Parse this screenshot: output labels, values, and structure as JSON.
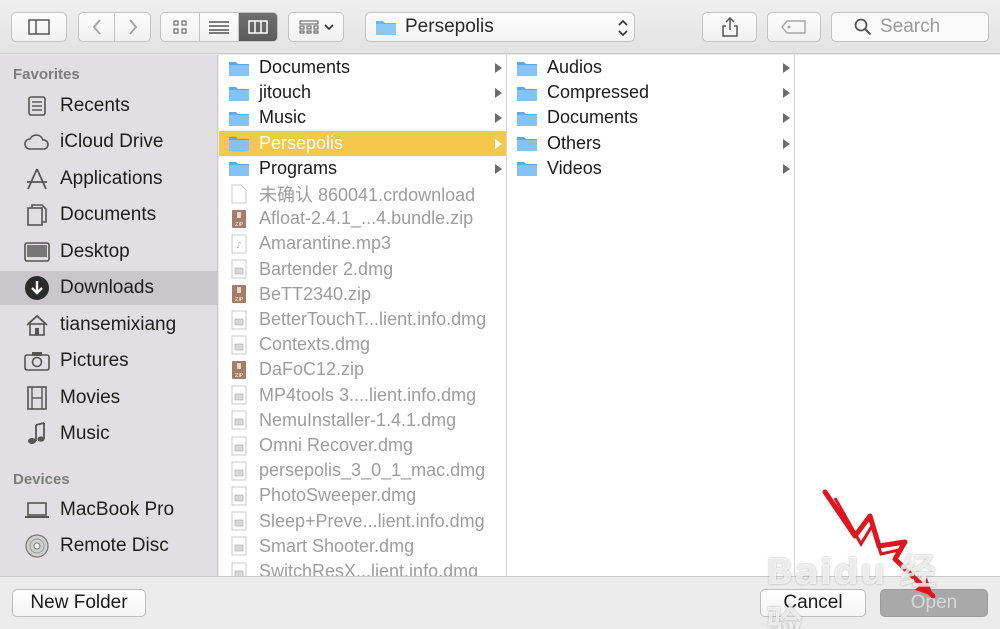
{
  "toolbar": {
    "path_label": "Persepolis",
    "search_placeholder": "Search"
  },
  "sidebar": {
    "favorites_header": "Favorites",
    "favorites": [
      {
        "label": "Recents",
        "icon": "recents-icon"
      },
      {
        "label": "iCloud Drive",
        "icon": "cloud-icon"
      },
      {
        "label": "Applications",
        "icon": "applications-icon"
      },
      {
        "label": "Documents",
        "icon": "document-icon"
      },
      {
        "label": "Desktop",
        "icon": "desktop-icon"
      },
      {
        "label": "Downloads",
        "icon": "download-icon",
        "selected": true
      },
      {
        "label": "tiansemixiang",
        "icon": "home-icon"
      },
      {
        "label": "Pictures",
        "icon": "camera-icon"
      },
      {
        "label": "Movies",
        "icon": "film-icon"
      },
      {
        "label": "Music",
        "icon": "music-note-icon"
      }
    ],
    "devices_header": "Devices",
    "devices": [
      {
        "label": "MacBook Pro",
        "icon": "laptop-icon"
      },
      {
        "label": "Remote Disc",
        "icon": "disc-icon"
      }
    ]
  },
  "column1": {
    "items": [
      {
        "label": "Documents",
        "kind": "folder"
      },
      {
        "label": "jitouch",
        "kind": "folder"
      },
      {
        "label": "Music",
        "kind": "folder"
      },
      {
        "label": "Persepolis",
        "kind": "folder",
        "selected": true
      },
      {
        "label": "Programs",
        "kind": "folder"
      },
      {
        "label": "未确认 860041.crdownload",
        "kind": "blank"
      },
      {
        "label": "Afloat-2.4.1_...4.bundle.zip",
        "kind": "zip"
      },
      {
        "label": "Amarantine.mp3",
        "kind": "audio"
      },
      {
        "label": "Bartender 2.dmg",
        "kind": "dmg"
      },
      {
        "label": "BeTT2340.zip",
        "kind": "zip"
      },
      {
        "label": "BetterTouchT...lient.info.dmg",
        "kind": "dmg"
      },
      {
        "label": "Contexts.dmg",
        "kind": "dmg"
      },
      {
        "label": "DaFoC12.zip",
        "kind": "zip"
      },
      {
        "label": "MP4tools 3....lient.info.dmg",
        "kind": "dmg"
      },
      {
        "label": "NemuInstaller-1.4.1.dmg",
        "kind": "dmg"
      },
      {
        "label": "Omni Recover.dmg",
        "kind": "dmg"
      },
      {
        "label": "persepolis_3_0_1_mac.dmg",
        "kind": "dmg"
      },
      {
        "label": "PhotoSweeper.dmg",
        "kind": "dmg"
      },
      {
        "label": "Sleep+Preve...lient.info.dmg",
        "kind": "dmg"
      },
      {
        "label": "Smart Shooter.dmg",
        "kind": "dmg"
      },
      {
        "label": "SwitchResX...lient.info.dmg",
        "kind": "dmg"
      }
    ]
  },
  "column2": {
    "items": [
      {
        "label": "Audios"
      },
      {
        "label": "Compressed"
      },
      {
        "label": "Documents"
      },
      {
        "label": "Others"
      },
      {
        "label": "Videos"
      }
    ]
  },
  "bottom": {
    "new_folder": "New Folder",
    "cancel": "Cancel",
    "open": "Open"
  },
  "watermark": "Baidu 经验",
  "colors": {
    "selection": "#f4c84a",
    "folder": "#6cb3f0",
    "sidebar_bg": "#e1dfe4",
    "sidebar_selected": "#c9c6cc"
  }
}
